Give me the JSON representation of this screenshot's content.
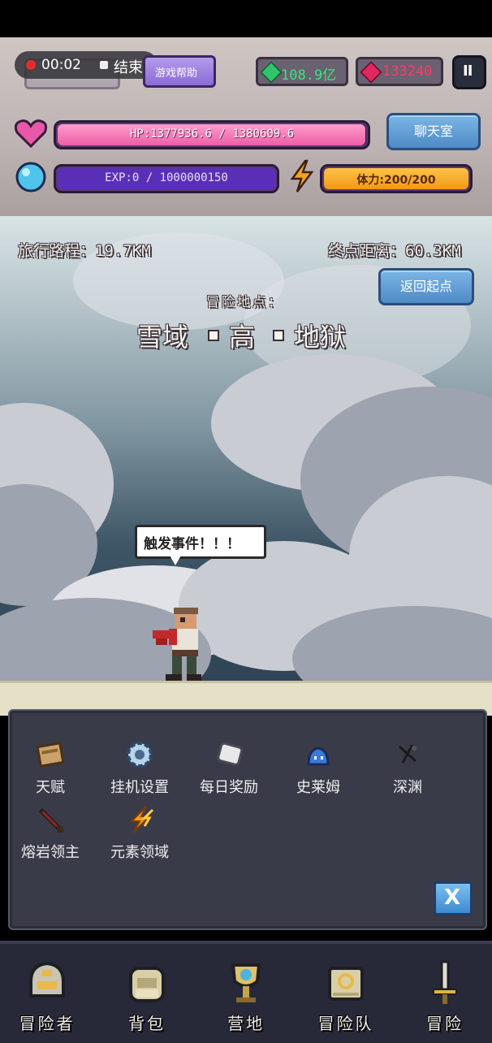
{
  "recording": {
    "time": "00:02",
    "end_label": "结束"
  },
  "top": {
    "help_label": "游戏帮助",
    "gems": "108.9亿",
    "rubies": "133240",
    "pause_symbol": "II"
  },
  "hp": {
    "text": "HP:1377936.6 / 1380609.6",
    "fraction": 0.998
  },
  "exp": {
    "text": "EXP:0 / 1000000150",
    "fraction": 0.0
  },
  "stamina": {
    "text": "体力:200/200",
    "fraction": 1.0
  },
  "chat_label": "聊天室",
  "travel": {
    "distance": "旅行路程：19.7KM",
    "remaining": "终点距离：60.3KM",
    "return_label": "返回起点"
  },
  "location": {
    "caption": "冒险地点：",
    "name_parts": [
      "雪域",
      "高",
      "地狱"
    ]
  },
  "speech": "触发事件！！！",
  "menu": {
    "items": [
      {
        "label": "天赋",
        "icon": "book-icon"
      },
      {
        "label": "挂机设置",
        "icon": "gear-icon"
      },
      {
        "label": "每日奖励",
        "icon": "scroll-icon"
      },
      {
        "label": "史莱姆",
        "icon": "slime-icon"
      },
      {
        "label": "深渊",
        "icon": "abyss-icon"
      },
      {
        "label": "熔岩领主",
        "icon": "sword-icon"
      },
      {
        "label": "元素领域",
        "icon": "lightning-icon"
      }
    ],
    "close_label": "X"
  },
  "nav": {
    "items": [
      {
        "label": "冒险者",
        "icon": "helmet-icon"
      },
      {
        "label": "背包",
        "icon": "backpack-icon"
      },
      {
        "label": "营地",
        "icon": "trophy-icon"
      },
      {
        "label": "冒险队",
        "icon": "guild-book-icon"
      },
      {
        "label": "冒险",
        "icon": "adventure-sword-icon"
      }
    ]
  },
  "colors": {
    "hp": "#f06aa8",
    "exp": "#6a3ad6",
    "stamina": "#f5a21c",
    "panel": "#3a3b49",
    "nav": "#272838"
  }
}
